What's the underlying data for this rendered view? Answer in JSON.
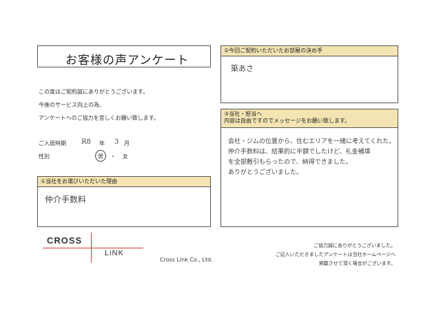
{
  "title": "お客様の声アンケート",
  "intro": [
    "この度はご契約誠にありがとうございます。",
    "今後のサービス向上の為、",
    "アンケートへのご協力を宜しくお願い致します。"
  ],
  "move_in": {
    "label": "ご入居時期",
    "year_value": "R8",
    "year_unit": "年",
    "month_value": "3",
    "month_unit": "月"
  },
  "gender": {
    "label": "性別",
    "male": "男",
    "separator": "・",
    "female": "女",
    "selected": "男"
  },
  "deciding_factor": {
    "heading": "②今回ご契約いただいたお部屋の決め手",
    "answer": "築あさ"
  },
  "message": {
    "heading_line1": "③当社・担当へ",
    "heading_line2": "内容は自由ですのでメッセージをお願い致します。",
    "answer_lines": [
      "会社・ジムの位置から、住むエリアを一緒に考えてくれた。",
      "仲介手数料は、結果的に半額でしたけど、礼金補填",
      "を全部敷引もらったので、納得できました。",
      "ありがとうございました。"
    ]
  },
  "reason": {
    "heading": "①当社をお選びいただいた理由",
    "answer": "仲介手数料"
  },
  "logo": {
    "word1": "CROSS",
    "word2": "LiNK"
  },
  "company": "Cross Link Co., Ltd.",
  "footer": [
    "ご協力誠にありがとうございました。",
    "ご記入いただきましたアンケートは当社ホームページへ",
    "掲載させて頂く場合がございます。"
  ],
  "colors": {
    "heading_bg": "#f3e4b2",
    "logo_line": "#d23a3a"
  }
}
